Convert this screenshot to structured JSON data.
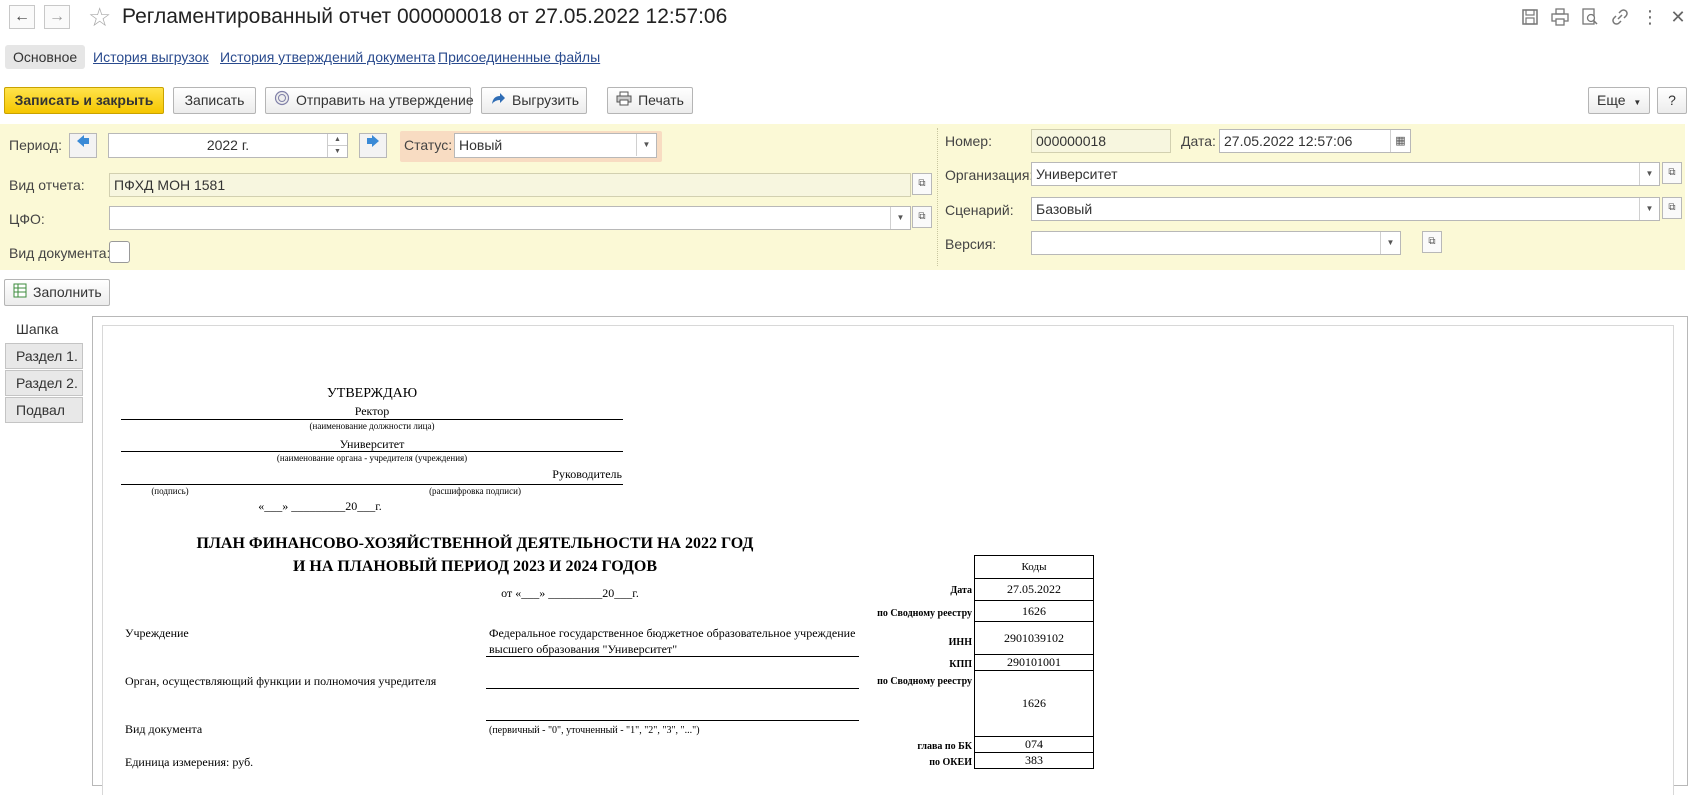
{
  "window": {
    "title": "Регламентированный отчет 000000018 от 27.05.2022 12:57:06"
  },
  "tabs": {
    "main": "Основное",
    "history_upload": "История выгрузок",
    "history_approval": "История утверждений документа",
    "attached_files": "Присоединенные файлы"
  },
  "toolbar": {
    "save_close": "Записать и закрыть",
    "save": "Записать",
    "send_approval": "Отправить на утверждение",
    "export": "Выгрузить",
    "print": "Печать",
    "more": "Еще",
    "help": "?"
  },
  "form": {
    "period_label": "Период:",
    "period_value": "2022 г.",
    "status_label": "Статус:",
    "status_value": "Новый",
    "report_type_label": "Вид отчета:",
    "report_type_value": "ПФХД МОН 1581",
    "cfo_label": "ЦФО:",
    "cfo_value": "",
    "doc_type_label": "Вид документа:",
    "number_label": "Номер:",
    "number_value": "000000018",
    "date_label": "Дата:",
    "date_value": "27.05.2022 12:57:06",
    "org_label": "Организация:",
    "org_value": "Университет",
    "scenario_label": "Сценарий:",
    "scenario_value": "Базовый",
    "version_label": "Версия:",
    "version_value": ""
  },
  "fill_button": "Заполнить",
  "side_tabs": [
    "Шапка",
    "Раздел 1.",
    "Раздел 2.",
    "Подвал"
  ],
  "doc": {
    "approve": "УТВЕРЖДАЮ",
    "rector": "Ректор",
    "position_caption": "(наименование должности лица)",
    "university": "Университет",
    "organ_caption": "(наименование органа - учредителя (учреждения)",
    "head": "Руководитель",
    "signature_caption": "(подпись)",
    "decode_caption": "(расшифровка подписи)",
    "date_line": "«___» _________20___г.",
    "plan_title_1": "ПЛАН ФИНАНСОВО-ХОЗЯЙСТВЕННОЙ ДЕЯТЕЛЬНОСТИ НА 2022 ГОД",
    "plan_title_2": "И НА ПЛАНОВЫЙ ПЕРИОД  2023 И 2024 ГОДОВ",
    "from_date": "от «___» _________20___г.",
    "institution_label": "Учреждение",
    "institution_value_1": "Федеральное государственное бюджетное образовательное учреждение",
    "institution_value_2": "высшего образования \"Университет\"",
    "founder_label": "Орган, осуществляющий функции и полномочия учредителя",
    "doc_kind_label": "Вид документа",
    "doc_kind_caption": "(первичный - \"0\", уточненный - \"1\", \"2\", \"3\", \"...\")",
    "unit_label": "Единица измерения: руб.",
    "codes_header": "Коды",
    "code_labels": {
      "date": "Дата",
      "registry1": "по Сводному реестру",
      "inn": "ИНН",
      "kpp": "КПП",
      "registry2": "по Сводному реестру",
      "bk": "глава по БК",
      "okei": "по ОКЕИ"
    },
    "code_values": {
      "date": "27.05.2022",
      "registry1": "1626",
      "inn": "2901039102",
      "kpp": "290101001",
      "registry2": "1626",
      "bk": "074",
      "okei": "383"
    }
  }
}
